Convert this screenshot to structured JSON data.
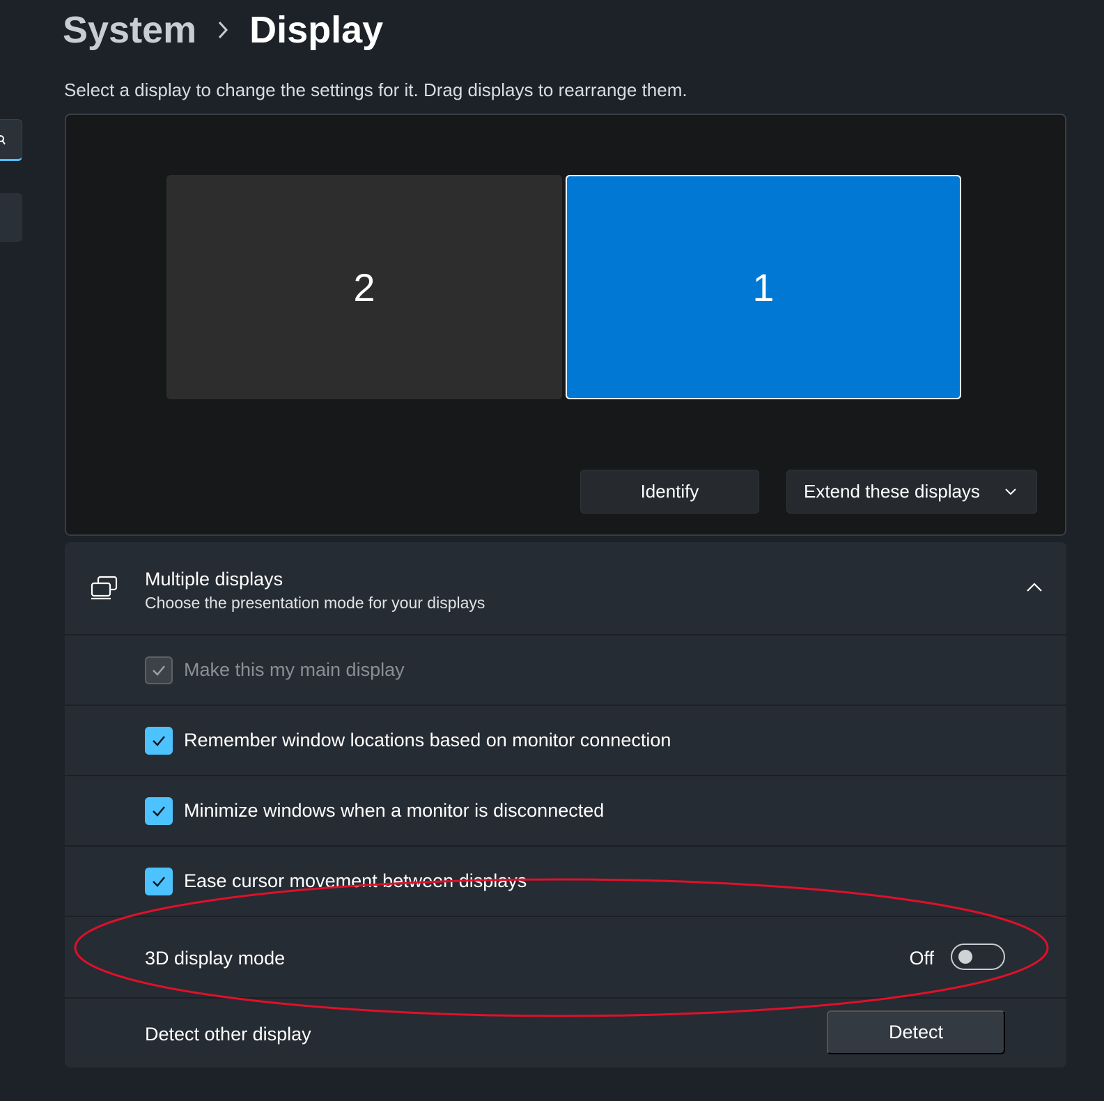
{
  "breadcrumb": {
    "parent": "System",
    "current": "Display"
  },
  "description": "Select a display to change the settings for it. Drag displays to rearrange them.",
  "displays": [
    {
      "label": "2",
      "selected": false
    },
    {
      "label": "1",
      "selected": true
    }
  ],
  "actions": {
    "identify_label": "Identify",
    "mode_select_value": "Extend these displays"
  },
  "multiple_displays": {
    "title": "Multiple displays",
    "subtitle": "Choose the presentation mode for your displays",
    "options": [
      {
        "label": "Make this my main display",
        "checked": true,
        "disabled": true
      },
      {
        "label": "Remember window locations based on monitor connection",
        "checked": true,
        "disabled": false
      },
      {
        "label": "Minimize windows when a monitor is disconnected",
        "checked": true,
        "disabled": false
      },
      {
        "label": "Ease cursor movement between displays",
        "checked": true,
        "disabled": false
      }
    ],
    "three_d": {
      "label": "3D display mode",
      "state_label": "Off",
      "on": false
    },
    "detect": {
      "label": "Detect other display",
      "button_label": "Detect"
    }
  },
  "colors": {
    "accent": "#0078d4",
    "checkbox_accent": "#4cc2ff",
    "annotation": "#e0102a"
  }
}
